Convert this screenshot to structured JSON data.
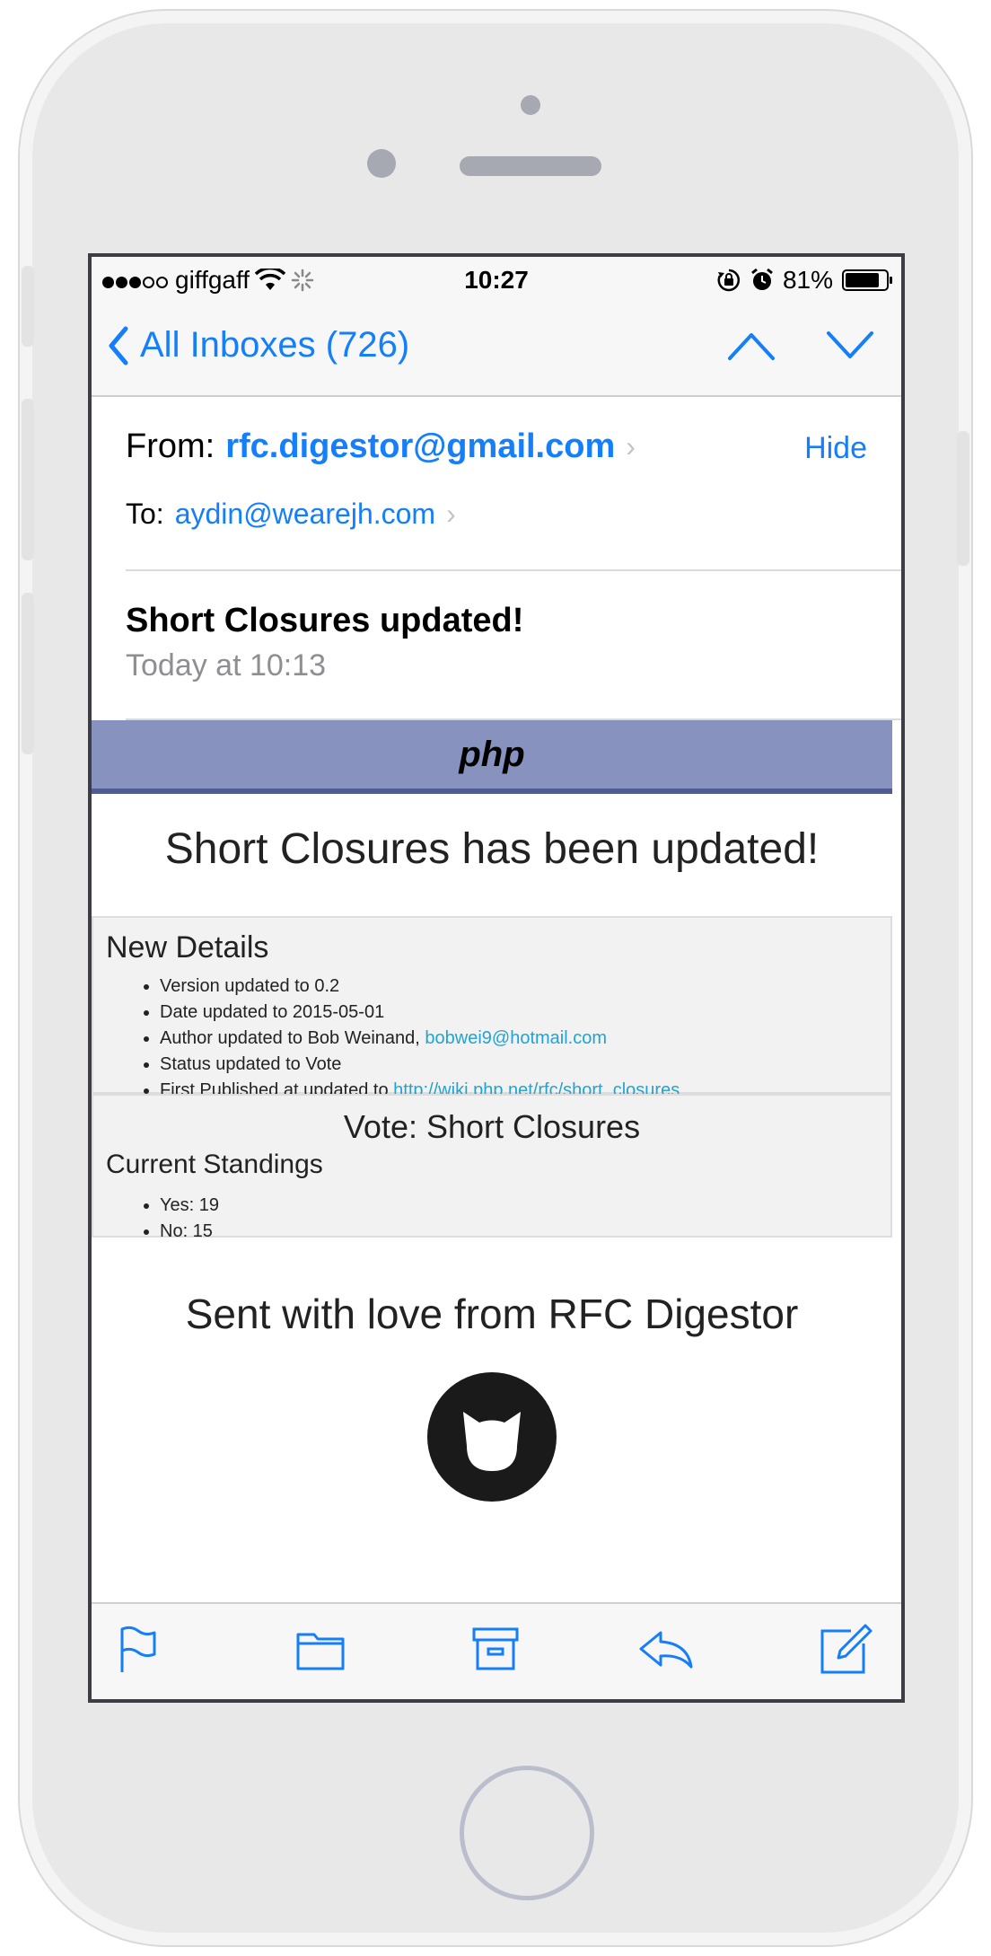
{
  "status_bar": {
    "carrier": "giffgaff",
    "time": "10:27",
    "battery_percent": "81%",
    "battery_level": 0.81,
    "signal_bars": 3
  },
  "nav": {
    "back_label": "All Inboxes (726)",
    "icons": [
      "chevron-left-icon",
      "chevron-up-icon",
      "chevron-down-icon"
    ]
  },
  "header": {
    "from_label": "From:",
    "from_address": "rfc.digestor@gmail.com",
    "hide_label": "Hide",
    "to_label": "To:",
    "to_address": "aydin@wearejh.com",
    "subject": "Short Closures updated!",
    "date": "Today at 10:13"
  },
  "email": {
    "banner": "php",
    "headline": "Short Closures has been updated!",
    "details": {
      "title": "New Details",
      "items": [
        {
          "text": "Version updated to 0.2",
          "link": ""
        },
        {
          "text": "Date updated to 2015-05-01",
          "link": ""
        },
        {
          "text": "Author updated to Bob Weinand, ",
          "link": "bobwei9@hotmail.com"
        },
        {
          "text": "Status updated to Vote",
          "link": ""
        },
        {
          "text": "First Published at updated to ",
          "link": "http://wiki.php.net/rfc/short_closures"
        }
      ]
    },
    "vote": {
      "title": "Vote: Short Closures",
      "subtitle": "Current Standings",
      "items": [
        "Yes: 19",
        "No: 15"
      ]
    },
    "footer": "Sent with love from RFC Digestor"
  },
  "toolbar": {
    "icons": [
      "flag-icon",
      "folder-icon",
      "archive-icon",
      "reply-icon",
      "compose-icon"
    ]
  },
  "colors": {
    "accent": "#147efb",
    "php_banner": "#8892bf",
    "php_banner_border": "#4f5b93",
    "link": "#23a3cf"
  }
}
